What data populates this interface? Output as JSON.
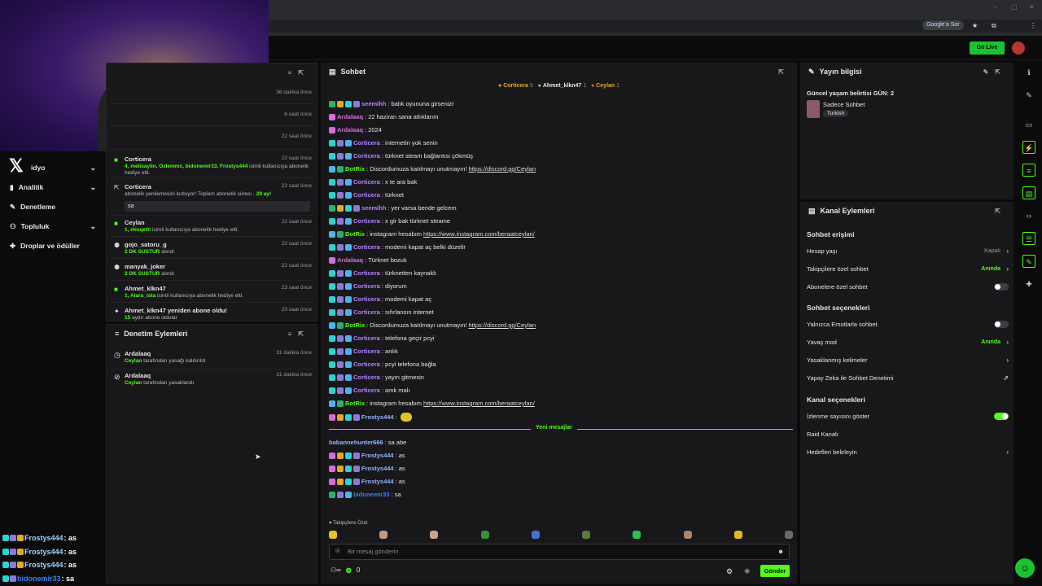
{
  "browser": {
    "google_pill": "Google'a Sor"
  },
  "topbar": {
    "golive": "Go Live"
  },
  "leftnav": {
    "video": "idyo",
    "analytics": "Analitik",
    "moderation": "Denetleme",
    "community": "Topluluk",
    "drops": "Droplar ve ödüller"
  },
  "activity": {
    "times_top": [
      "36 dakika önce",
      "6 saat önce",
      "22 saat önce"
    ],
    "rows": [
      {
        "name": "Corticera",
        "time": "22 saat önce",
        "sub_names": "4, melisaylin, Ozlemmx, bidonemir33, Frostys444",
        "sub_text": " isimli kullanıcıya abonelik hediye etti."
      },
      {
        "name": "Corticera",
        "time": "22 saat önce",
        "sub_text": "abonelik yenilemesini kutluyor! Toplam abonelik süresi - ",
        "sub_months": "29 ay!",
        "note": "sa"
      },
      {
        "name": "Ceylan",
        "time": "22 saat önce",
        "sub_names": "1, misqetti",
        "sub_text": " isimli kullanıcıya abonelik hediye etti."
      },
      {
        "name": "gojo_satoru_g",
        "time": "22 saat önce",
        "sub_names": "2 DK SUSTUR",
        "sub_text": " alındı"
      },
      {
        "name": "manyak_joker",
        "time": "22 saat önce",
        "sub_names": "2 DK SUSTUR",
        "sub_text": " alındı"
      },
      {
        "name": "Ahmet_klkn47",
        "time": "23 saat önce",
        "sub_names": "1, Alara_ista",
        "sub_text": " isimli kullanıcıya abonelik hediye etti."
      },
      {
        "name": "Ahmet_klkn47 yeniden abone oldu!",
        "time": "23 saat önce",
        "sub_names": "15",
        "sub_text": " aydır abone oldular"
      }
    ]
  },
  "modlog": {
    "title": "Denetim Eylemleri",
    "rows": [
      {
        "name": "Ardalaaq",
        "time": "31 dakika önce",
        "by": "Ceylan",
        "text": " tarafından yasağı kaldırıldı"
      },
      {
        "name": "Ardalaaq",
        "time": "31 dakika önce",
        "by": "Ceylan",
        "text": " tarafından yasaklandı"
      }
    ]
  },
  "chat": {
    "title": "Sohbet",
    "pinned": [
      {
        "name": "Corticera",
        "count": "5"
      },
      {
        "name": "Ahmet_klkn47",
        "count": "1"
      },
      {
        "name": "Ceylan",
        "count": "1"
      }
    ],
    "messages": [
      {
        "user": "seemihh",
        "text": "balık oyununa girsenizr"
      },
      {
        "user": "Ardalaaq",
        "text": "22 haziran sana attıklarım"
      },
      {
        "user": "Ardalaaq",
        "text": "2024"
      },
      {
        "user": "Corticera",
        "text": "internetin yok senin"
      },
      {
        "user": "Corticera",
        "text": "türknet steam bağlantısı çökmüş"
      },
      {
        "user": "BotRix",
        "text": "Discordumuza katılmayı unutmayın! ",
        "link": "https://discord.gg/Ceylan"
      },
      {
        "user": "Corticera",
        "text": "x te ara bak"
      },
      {
        "user": "Corticera",
        "text": "türknet"
      },
      {
        "user": "seemihh",
        "text": "yer varsa bende gelcem"
      },
      {
        "user": "Corticera",
        "text": "x gir bak türknet steame"
      },
      {
        "user": "BotRix",
        "text": "instagram hesabım ",
        "link": "https://www.instagram.com/beraatceylan/"
      },
      {
        "user": "Corticera",
        "text": "modemi kapat aç belki düzelir"
      },
      {
        "user": "Ardalaaq",
        "text": "Türknet bozuk"
      },
      {
        "user": "Corticera",
        "text": "türknetten kaynaklı"
      },
      {
        "user": "Corticera",
        "text": "diyorum"
      },
      {
        "user": "Corticera",
        "text": "modemi kapat aç"
      },
      {
        "user": "Corticera",
        "text": "sıfırlansın internet"
      },
      {
        "user": "BotRix",
        "text": "Discordumuza katılmayı unutmayın! ",
        "link": "https://discord.gg/Ceylan"
      },
      {
        "user": "Corticera",
        "text": "telefona geçir pcyi"
      },
      {
        "user": "Corticera",
        "text": "anlık"
      },
      {
        "user": "Corticera",
        "text": "pcyi telefona bağla"
      },
      {
        "user": "Corticera",
        "text": "yayın gitmesin"
      },
      {
        "user": "Corticera",
        "text": "amk malı"
      },
      {
        "user": "BotRix",
        "text": "instagram hesabım ",
        "link": "https://www.instagram.com/beraatceylan/"
      },
      {
        "user": "Frostys444",
        "text": ""
      }
    ],
    "new_messages": "Yeni mesajlar",
    "after": [
      {
        "user": "babannehunter666",
        "text": "sa abe"
      },
      {
        "user": "Frostys444",
        "text": "as"
      },
      {
        "user": "Frostys444",
        "text": "as"
      },
      {
        "user": "Frostys444",
        "text": "as"
      },
      {
        "user": "bidonemir33",
        "text": "sa"
      }
    ],
    "emote_label": "Takipçilere Özel",
    "placeholder": "Bir mesaj gönderin",
    "points": "0",
    "send": "Gönder"
  },
  "stream_info": {
    "title": "Yayın bilgisi",
    "stream_title": "Güncel yaşam belirtisi GÜN: 2",
    "category": "Sadece Sohbet",
    "language": "Turkish"
  },
  "channel_actions": {
    "title": "Kanal Eylemleri",
    "chat_access": "Sohbet erişimi",
    "account_age": "Hesap yaşı",
    "account_age_val": "Kapalı",
    "followers_only": "Takipçilere özel sohbet",
    "followers_only_val": "Anında",
    "subs_only": "Abonelere özel sohbet",
    "chat_options": "Sohbet seçenekleri",
    "emotes_only": "Yalnızca Emotlarla sohbet",
    "slow_mode": "Yavaş mod",
    "slow_mode_val": "Anında",
    "banned_words": "Yasaklanmış kelimeler",
    "ai_mod": "Yapay Zeka ile Sohbet Denetimi",
    "channel_options": "Kanal seçenekleri",
    "show_viewers": "İzlenme sayısını göster",
    "raid": "Raid Kanalı",
    "goals": "Hedefleri belirleyin"
  },
  "overlay_chat": [
    {
      "user": "Frostys444",
      "text": " : as"
    },
    {
      "user": "Frostys444",
      "text": " : as"
    },
    {
      "user": "Frostys444",
      "text": " : as"
    },
    {
      "user": "bidonemir33",
      "text": " : sa"
    }
  ]
}
